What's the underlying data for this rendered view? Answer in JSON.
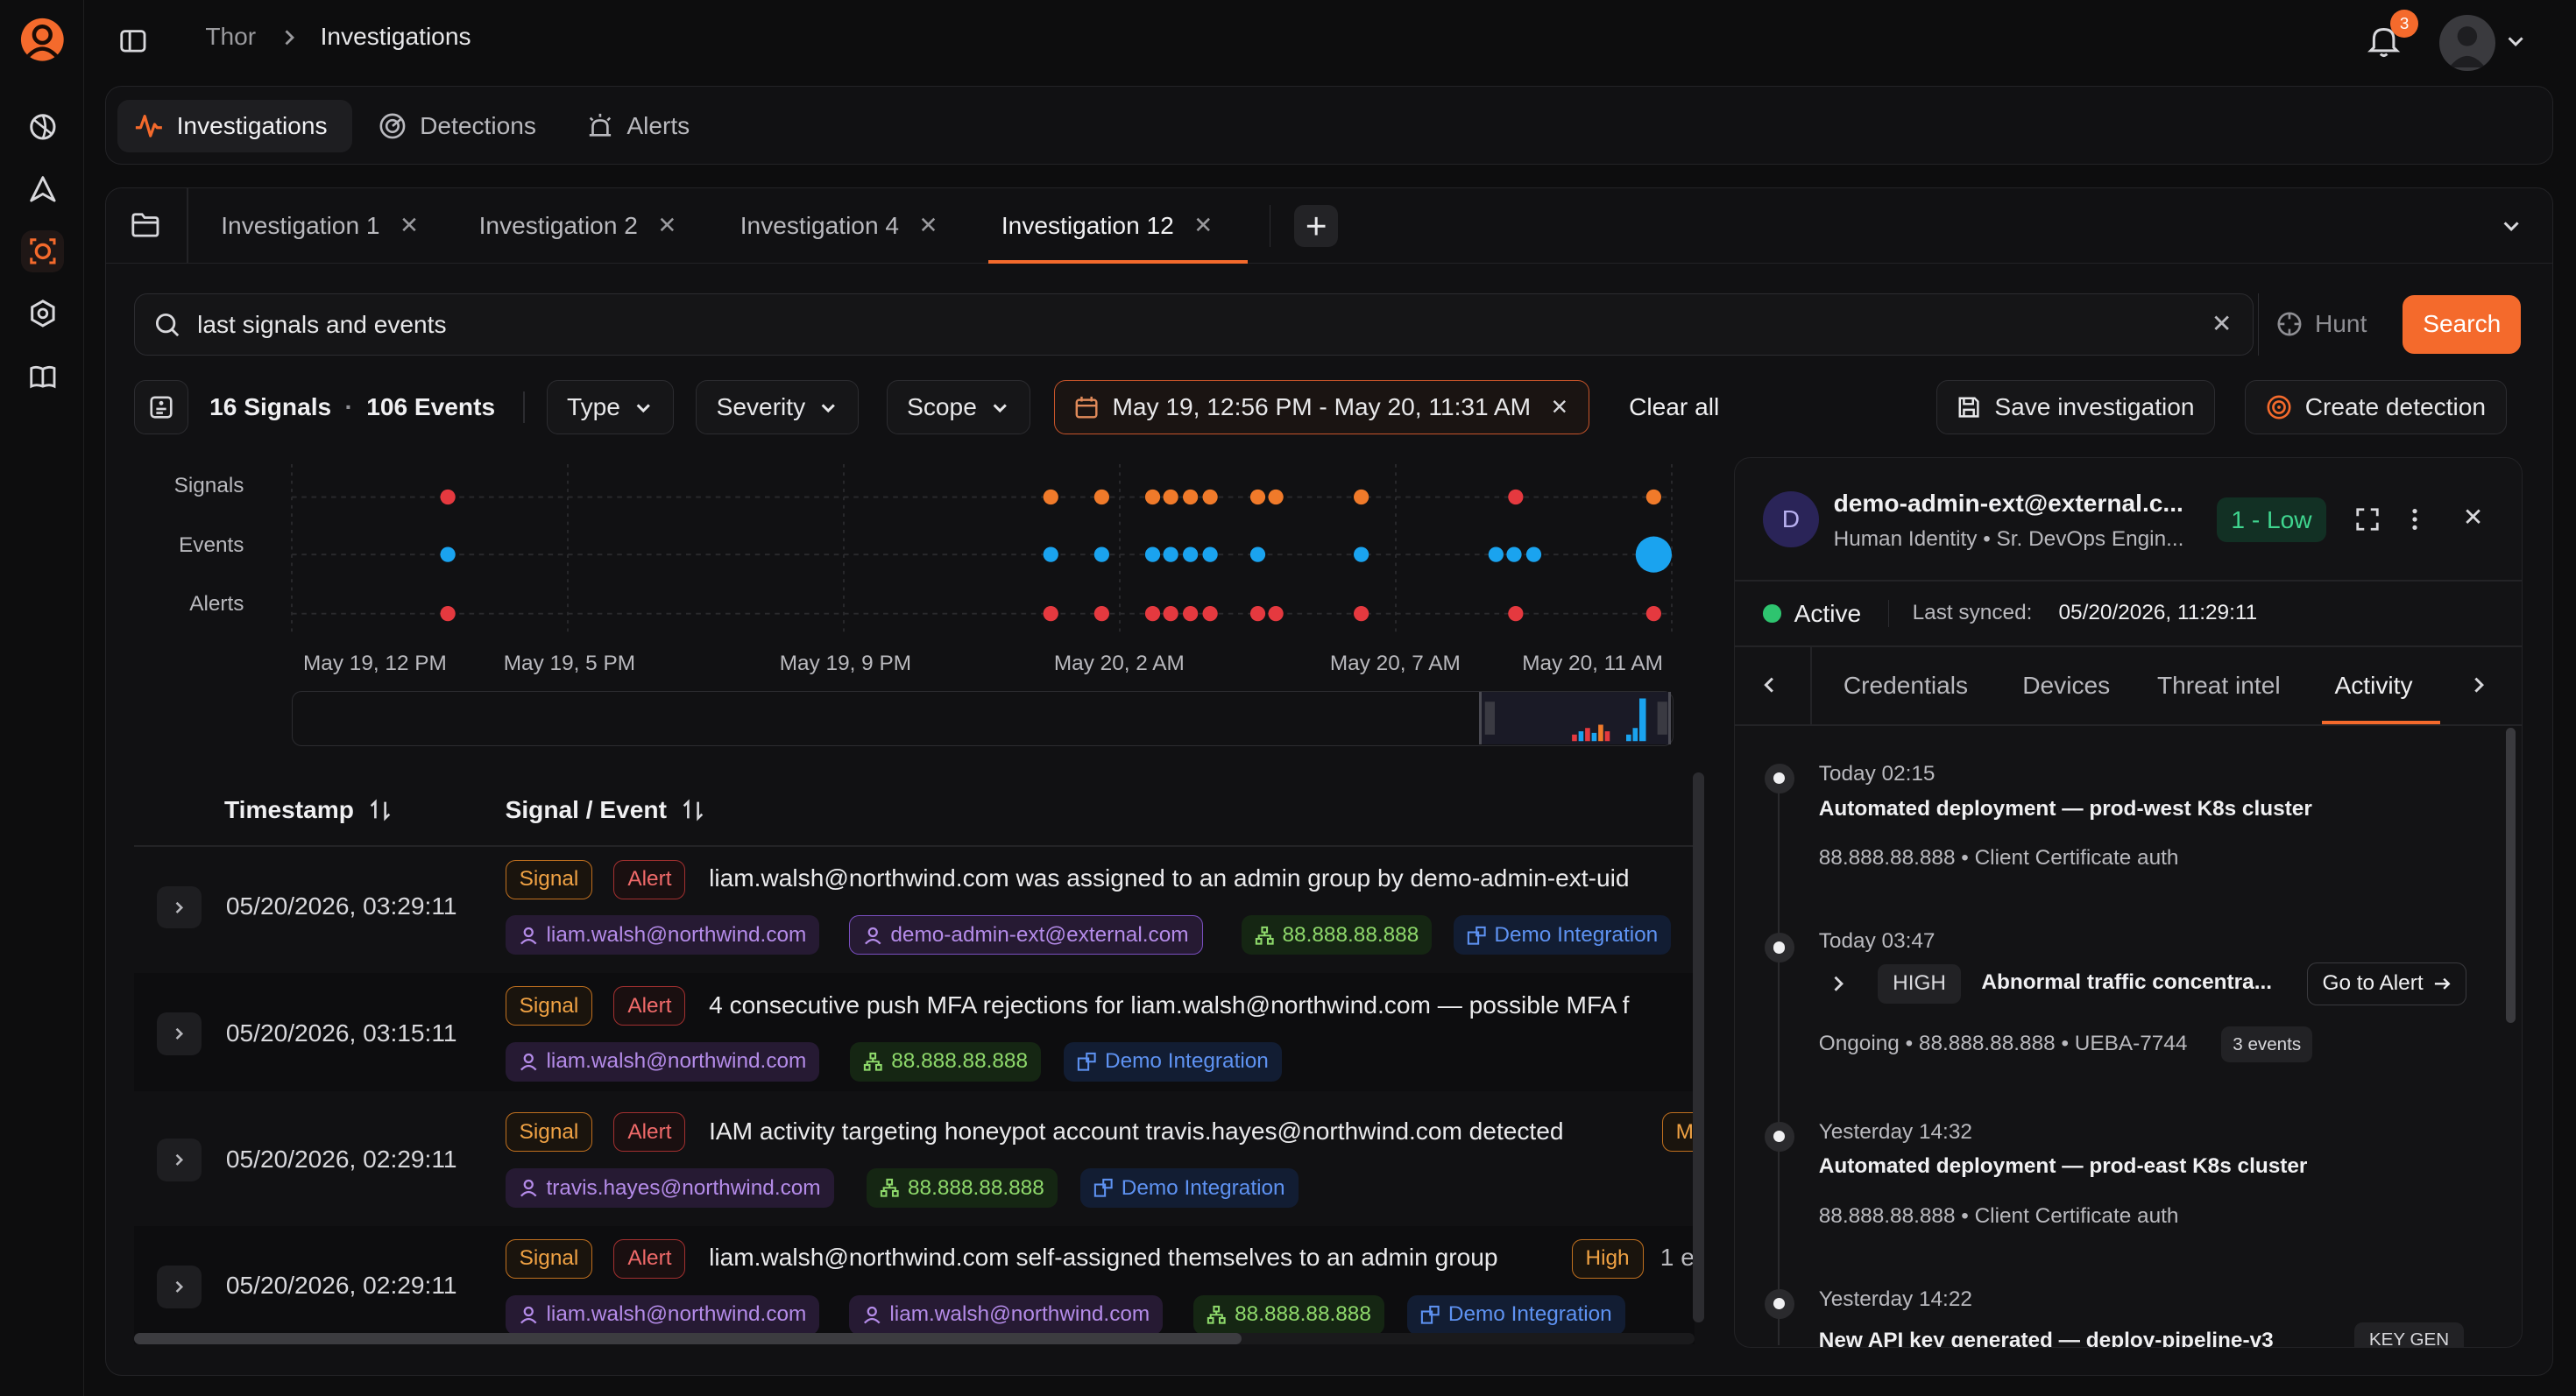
{
  "breadcrumb": {
    "root": "Thor",
    "current": "Investigations"
  },
  "notifications": {
    "count": "3"
  },
  "nav_tabs": [
    {
      "label": "Investigations",
      "icon": "activity-icon"
    },
    {
      "label": "Detections",
      "icon": "radar-icon"
    },
    {
      "label": "Alerts",
      "icon": "siren-icon"
    }
  ],
  "investigation_tabs": [
    {
      "label": "Investigation 1"
    },
    {
      "label": "Investigation 2"
    },
    {
      "label": "Investigation 4"
    },
    {
      "label": "Investigation 12"
    }
  ],
  "search": {
    "value": "last signals and events",
    "hunt_label": "Hunt",
    "button_label": "Search"
  },
  "filters": {
    "signals_count": "16 Signals",
    "separator": "·",
    "events_count": "106 Events",
    "type": "Type",
    "severity": "Severity",
    "scope": "Scope",
    "date_range": "May 19, 12:56 PM - May 20, 11:31 AM",
    "clear_all": "Clear all",
    "save": "Save investigation",
    "create": "Create detection"
  },
  "chart_data": {
    "type": "scatter",
    "rows": [
      "Signals",
      "Events",
      "Alerts"
    ],
    "x_ticks": [
      "May 19, 12 PM",
      "May 19, 5 PM",
      "May 19, 9 PM",
      "May 20, 2 AM",
      "May 20, 7 AM",
      "May 20, 11 AM"
    ],
    "colors": {
      "Signals": "#f07a2a",
      "Signals_alt": "#e5393f",
      "Events": "#1aa3ef",
      "Alerts": "#e5393f"
    }
  },
  "table": {
    "col_timestamp": "Timestamp",
    "col_signal": "Signal / Event",
    "rows": [
      {
        "timestamp": "05/20/2026, 03:29:11",
        "signal": "Signal",
        "alert": "Alert",
        "title": "liam.walsh@northwind.com was assigned to an admin group by demo-admin-ext-uid",
        "tags": [
          "liam.walsh@northwind.com",
          "demo-admin-ext@external.com",
          "88.888.88.888",
          "Demo Integration"
        ]
      },
      {
        "timestamp": "05/20/2026, 03:15:11",
        "signal": "Signal",
        "alert": "Alert",
        "title": "4 consecutive push MFA rejections for liam.walsh@northwind.com — possible MFA f",
        "tags": [
          "liam.walsh@northwind.com",
          "88.888.88.888",
          "Demo Integration"
        ]
      },
      {
        "timestamp": "05/20/2026, 02:29:11",
        "signal": "Signal",
        "alert": "Alert",
        "title": "IAM activity targeting honeypot account travis.hayes@northwind.com detected",
        "severity_partial": "M",
        "tags": [
          "travis.hayes@northwind.com",
          "88.888.88.888",
          "Demo Integration"
        ]
      },
      {
        "timestamp": "05/20/2026, 02:29:11",
        "signal": "Signal",
        "alert": "Alert",
        "title": "liam.walsh@northwind.com self-assigned themselves to an admin group",
        "severity": "High",
        "trailing": "1 e",
        "tags": [
          "liam.walsh@northwind.com",
          "liam.walsh@northwind.com",
          "88.888.88.888",
          "Demo Integration"
        ]
      }
    ]
  },
  "entity_panel": {
    "avatar_letter": "D",
    "name": "demo-admin-ext@external.c...",
    "subtitle": "Human Identity • Sr. DevOps Engin...",
    "risk": "1 - Low",
    "status": "Active",
    "last_synced_label": "Last synced:",
    "last_synced_value": "05/20/2026, 11:29:11",
    "tabs": [
      "Credentials",
      "Devices",
      "Threat intel",
      "Activity"
    ],
    "activity": [
      {
        "time": "Today 02:15",
        "title": "Automated deployment — prod-west K8s cluster",
        "meta": "88.888.88.888 • Client Certificate auth"
      },
      {
        "time": "Today 03:47",
        "severity": "HIGH",
        "title": "Abnormal traffic concentra...",
        "action": "Go to Alert",
        "meta": "Ongoing • 88.888.88.888 • UEBA-7744",
        "count": "3 events"
      },
      {
        "time": "Yesterday 14:32",
        "title": "Automated deployment — prod-east K8s cluster",
        "meta": "88.888.88.888 • Client Certificate auth"
      },
      {
        "time": "Yesterday 14:22",
        "title": "New API key generated — deploy-pipeline-v3",
        "tag": "KEY GEN"
      }
    ]
  }
}
